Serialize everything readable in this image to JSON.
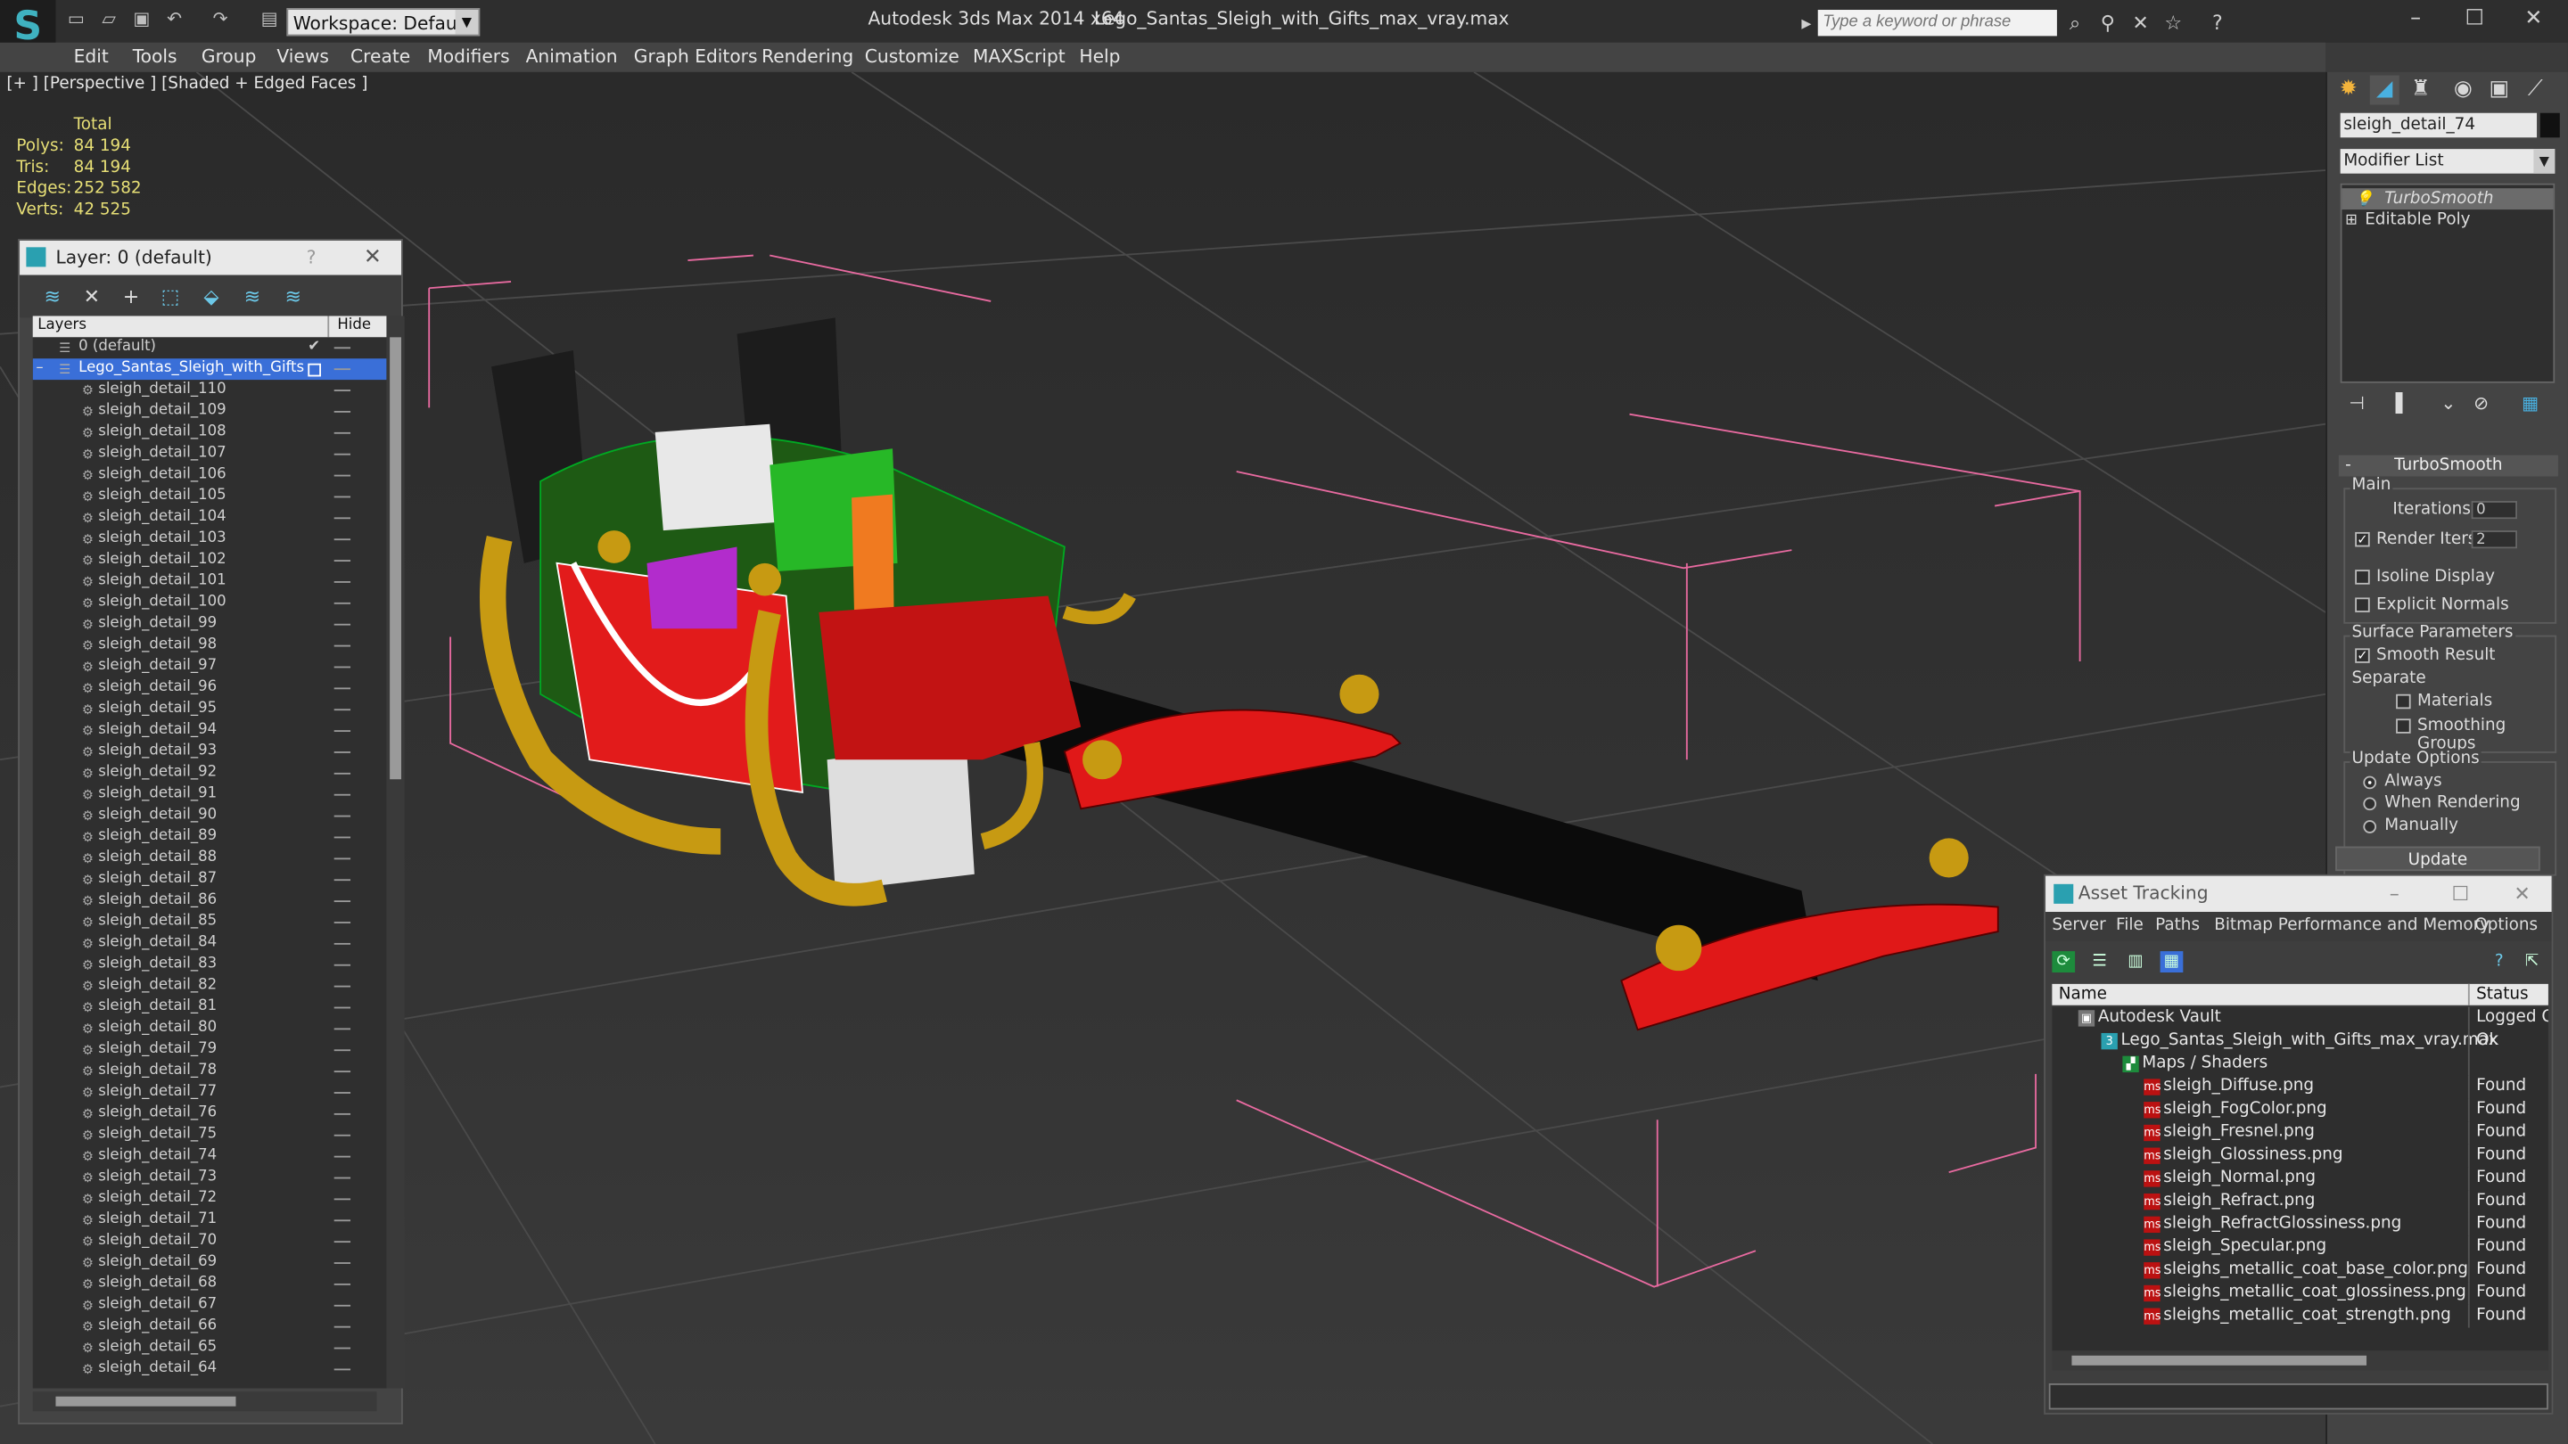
{
  "app": {
    "title": "Autodesk 3ds Max  2014 x64",
    "file": "Lego_Santas_Sleigh_with_Gifts_max_vray.max",
    "workspace": "Workspace: Default",
    "search_placeholder": "Type a keyword or phrase"
  },
  "menu": [
    "Edit",
    "Tools",
    "Group",
    "Views",
    "Create",
    "Modifiers",
    "Animation",
    "Graph Editors",
    "Rendering",
    "Customize",
    "MAXScript",
    "Help"
  ],
  "viewport": {
    "label": "[+ ] [Perspective ] [Shaded + Edged Faces ]",
    "stats": {
      "header": "Total",
      "rows": [
        {
          "label": "Polys:",
          "value": "84 194"
        },
        {
          "label": "Tris:",
          "value": "84 194"
        },
        {
          "label": "Edges:",
          "value": "252 582"
        },
        {
          "label": "Verts:",
          "value": "42 525"
        }
      ]
    }
  },
  "layer_panel": {
    "title": "Layer: 0 (default)",
    "help": "?",
    "col_layers": "Layers",
    "col_hide": "Hide",
    "default_layer": "0 (default)",
    "group_layer": "Lego_Santas_Sleigh_with_Gifts",
    "items": [
      "sleigh_detail_110",
      "sleigh_detail_109",
      "sleigh_detail_108",
      "sleigh_detail_107",
      "sleigh_detail_106",
      "sleigh_detail_105",
      "sleigh_detail_104",
      "sleigh_detail_103",
      "sleigh_detail_102",
      "sleigh_detail_101",
      "sleigh_detail_100",
      "sleigh_detail_99",
      "sleigh_detail_98",
      "sleigh_detail_97",
      "sleigh_detail_96",
      "sleigh_detail_95",
      "sleigh_detail_94",
      "sleigh_detail_93",
      "sleigh_detail_92",
      "sleigh_detail_91",
      "sleigh_detail_90",
      "sleigh_detail_89",
      "sleigh_detail_88",
      "sleigh_detail_87",
      "sleigh_detail_86",
      "sleigh_detail_85",
      "sleigh_detail_84",
      "sleigh_detail_83",
      "sleigh_detail_82",
      "sleigh_detail_81",
      "sleigh_detail_80",
      "sleigh_detail_79",
      "sleigh_detail_78",
      "sleigh_detail_77",
      "sleigh_detail_76",
      "sleigh_detail_75",
      "sleigh_detail_74",
      "sleigh_detail_73",
      "sleigh_detail_72",
      "sleigh_detail_71",
      "sleigh_detail_70",
      "sleigh_detail_69",
      "sleigh_detail_68",
      "sleigh_detail_67",
      "sleigh_detail_66",
      "sleigh_detail_65",
      "sleigh_detail_64"
    ]
  },
  "command_panel": {
    "object_name": "sleigh_detail_74",
    "modifier_list": "Modifier List",
    "stack": [
      "TurboSmooth",
      "Editable Poly"
    ],
    "turbosmooth": {
      "title": "TurboSmooth",
      "main": "Main",
      "iterations_label": "Iterations:",
      "iterations": "0",
      "render_iters_label": "Render Iters:",
      "render_iters": "2",
      "isoline": "Isoline Display",
      "explicit": "Explicit Normals",
      "surface": "Surface Parameters",
      "smooth_result": "Smooth Result",
      "separate": "Separate",
      "materials": "Materials",
      "smoothing_groups": "Smoothing Groups",
      "update_options": "Update Options",
      "always": "Always",
      "when_rendering": "When Rendering",
      "manually": "Manually",
      "update": "Update"
    }
  },
  "asset_tracking": {
    "title": "Asset Tracking",
    "menu": [
      "Server",
      "File",
      "Paths",
      "Bitmap Performance and Memory",
      "Options"
    ],
    "col_name": "Name",
    "col_status": "Status",
    "rows": [
      {
        "name": "Autodesk Vault",
        "status": "Logged Ou"
      },
      {
        "name": "Lego_Santas_Sleigh_with_Gifts_max_vray.max",
        "status": "Ok"
      },
      {
        "name": "Maps / Shaders",
        "status": ""
      },
      {
        "name": "sleigh_Diffuse.png",
        "status": "Found"
      },
      {
        "name": "sleigh_FogColor.png",
        "status": "Found"
      },
      {
        "name": "sleigh_Fresnel.png",
        "status": "Found"
      },
      {
        "name": "sleigh_Glossiness.png",
        "status": "Found"
      },
      {
        "name": "sleigh_Normal.png",
        "status": "Found"
      },
      {
        "name": "sleigh_Refract.png",
        "status": "Found"
      },
      {
        "name": "sleigh_RefractGlossiness.png",
        "status": "Found"
      },
      {
        "name": "sleigh_Specular.png",
        "status": "Found"
      },
      {
        "name": "sleighs_metallic_coat_base_color.png",
        "status": "Found"
      },
      {
        "name": "sleighs_metallic_coat_glossiness.png",
        "status": "Found"
      },
      {
        "name": "sleighs_metallic_coat_strength.png",
        "status": "Found"
      }
    ]
  },
  "colors": {
    "selection_blue": "#3a6fd8",
    "stat_yellow": "#e7df76",
    "bbox_pink": "#e86aa0"
  }
}
